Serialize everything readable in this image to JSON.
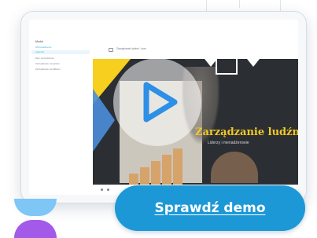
{
  "sidebar": {
    "title": "Moduł",
    "items": [
      {
        "label": "Wprowadzenie",
        "active": true
      },
      {
        "label": "Agenda",
        "active": true
      },
      {
        "label": "Moc zarządzania",
        "active": false
      },
      {
        "label": "Zarządzanie zespołem",
        "active": false
      },
      {
        "label": "Zarządzanie konfliktem",
        "active": false
      }
    ]
  },
  "topbar": {
    "course_title": "Zarządzanie ludźmi - kurs"
  },
  "video": {
    "title": "Zarządzanie ludźmi",
    "subtitle": "Liderzy i menadżerowie"
  },
  "cta": {
    "label": "Sprawdź demo"
  },
  "colors": {
    "accent": "#1c98d6",
    "video_title": "#f3c826",
    "logo_top": "#7ec6f5",
    "logo_bottom": "#a45ae8"
  },
  "icons": {
    "play": "play-icon",
    "menu": "menu-icon"
  }
}
